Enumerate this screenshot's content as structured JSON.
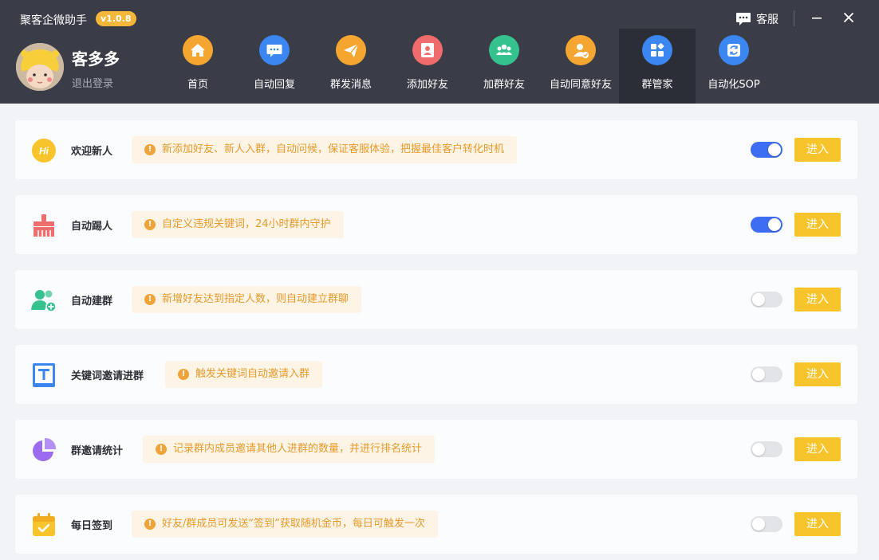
{
  "app": {
    "title": "聚客企微助手",
    "version": "v1.0.8"
  },
  "header": {
    "service_label": "客服"
  },
  "user": {
    "name": "客多多",
    "logout_label": "退出登录"
  },
  "nav": [
    {
      "label": "首页",
      "icon": "home-icon",
      "color": "#f5a630"
    },
    {
      "label": "自动回复",
      "icon": "chat-icon",
      "color": "#3b86f0"
    },
    {
      "label": "群发消息",
      "icon": "send-icon",
      "color": "#f5a630"
    },
    {
      "label": "添加好友",
      "icon": "add-user-icon",
      "color": "#f06b6b"
    },
    {
      "label": "加群好友",
      "icon": "group-icon",
      "color": "#35c28f"
    },
    {
      "label": "自动同意好友",
      "icon": "user-check-icon",
      "color": "#f5a630"
    },
    {
      "label": "群管家",
      "icon": "apps-icon",
      "color": "#3b86f0",
      "active": true
    },
    {
      "label": "自动化SOP",
      "icon": "sync-icon",
      "color": "#3b86f0"
    }
  ],
  "features": [
    {
      "title": "欢迎新人",
      "tip": "新添加好友、新人入群，自动问候，保证客服体验，把握最佳客户转化时机",
      "enabled": true,
      "icon": "hi-icon",
      "icon_text": "Hi",
      "color": "#f8c42c"
    },
    {
      "title": "自动踢人",
      "tip": "自定义违规关键词，24小时群内守护",
      "enabled": true,
      "icon": "broom-icon",
      "color": "#ef6d6d"
    },
    {
      "title": "自动建群",
      "tip": "新增好友达到指定人数，则自动建立群聊",
      "enabled": false,
      "icon": "add-group-icon",
      "color": "#35c28f"
    },
    {
      "title": "关键词邀请进群",
      "tip": "触发关键词自动邀请入群",
      "enabled": false,
      "icon": "text-t-icon",
      "color": "#3b86f0"
    },
    {
      "title": "群邀请统计",
      "tip": "记录群内成员邀请其他人进群的数量，并进行排名统计",
      "enabled": false,
      "icon": "pie-chart-icon",
      "color": "#9b6cf0"
    },
    {
      "title": "每日签到",
      "tip": "好友/群成员可发送“签到”获取随机金币，每日可触发一次",
      "enabled": false,
      "icon": "calendar-check-icon",
      "color": "#f8c42c"
    }
  ],
  "enter_label": "进入"
}
